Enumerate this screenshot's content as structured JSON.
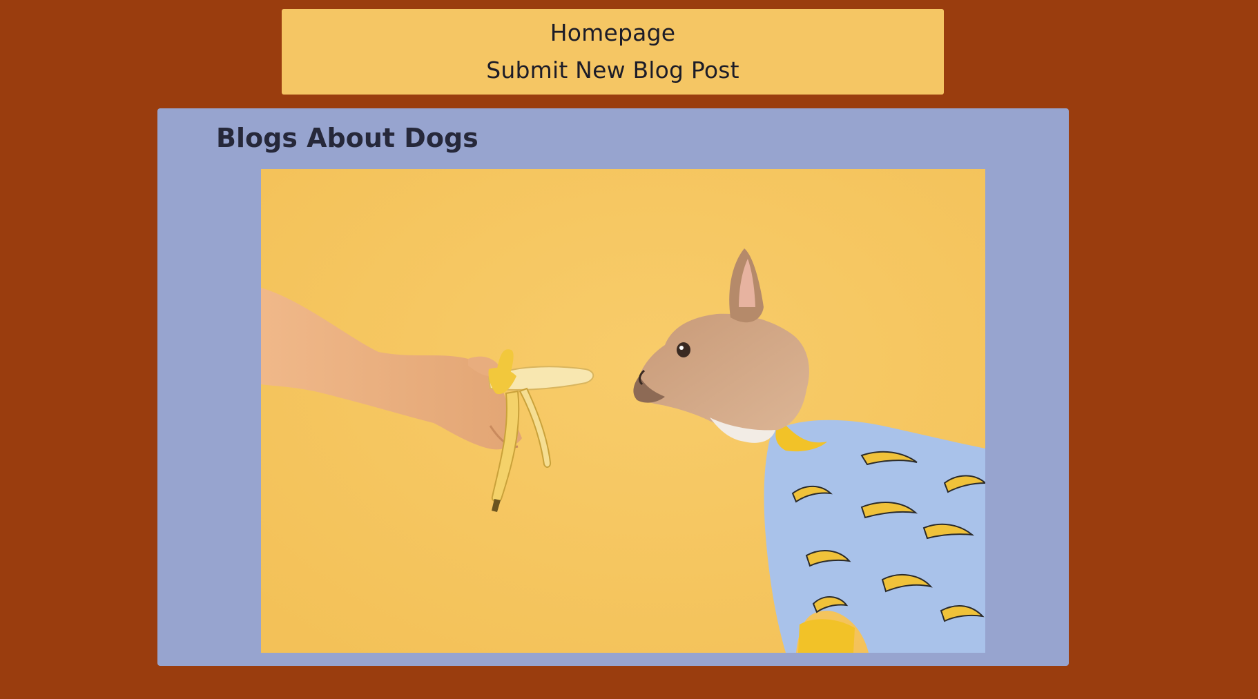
{
  "nav": {
    "items": [
      {
        "label": "Homepage"
      },
      {
        "label": "Submit New Blog Post"
      }
    ]
  },
  "main": {
    "title": "Blogs About Dogs",
    "image": {
      "icon": "dog-banana-photo",
      "alt": ""
    }
  },
  "colors": {
    "page_background": "#9a3d0e",
    "nav_background": "#f5c664",
    "card_background": "#97a4cf",
    "photo_background": "#f6c862",
    "text": "#1c1c28"
  }
}
